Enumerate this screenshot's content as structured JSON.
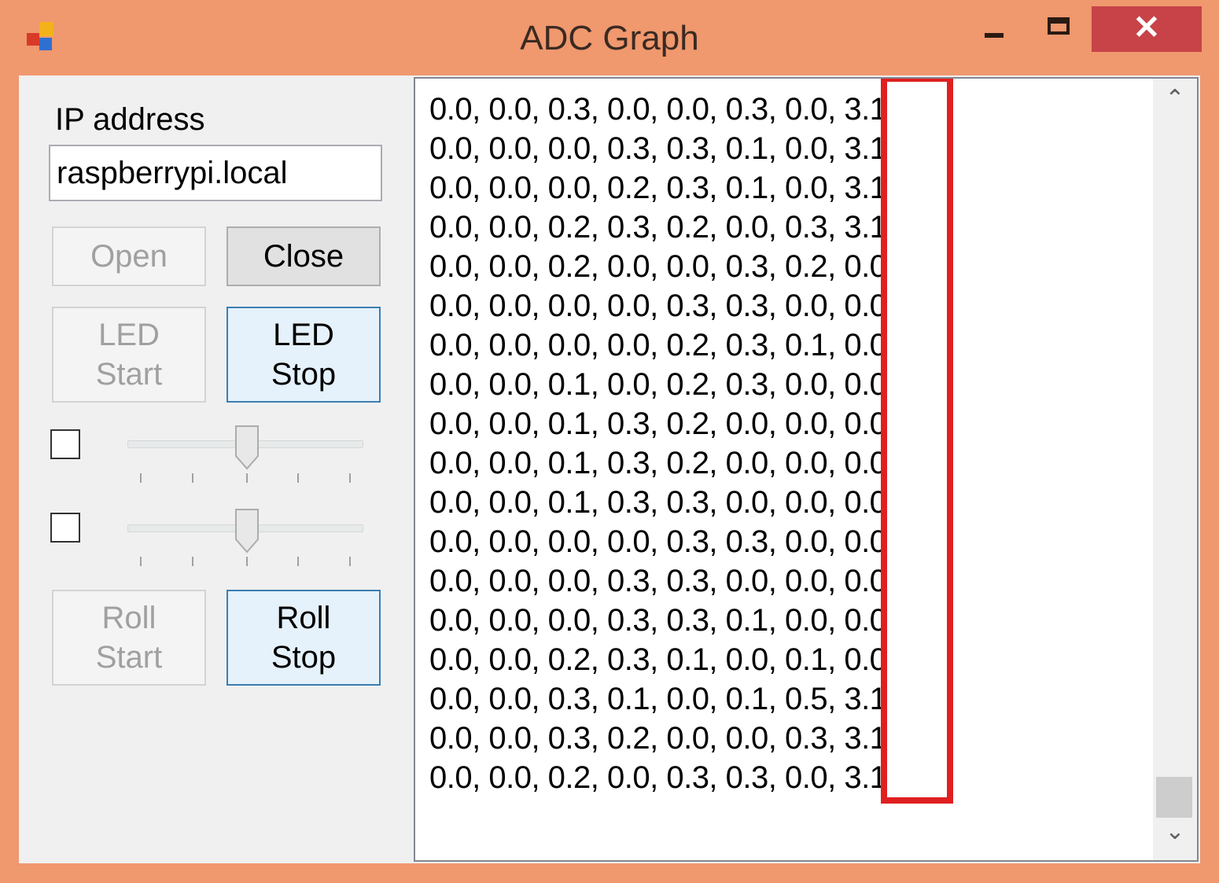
{
  "window": {
    "title": "ADC Graph"
  },
  "titlebar": {
    "minimize": "minimize-icon",
    "maximize": "maximize-icon",
    "close_glyph": "✕"
  },
  "connection": {
    "ip_label": "IP address",
    "ip_value": "raspberrypi.local",
    "open_label": "Open",
    "close_label": "Close"
  },
  "led": {
    "start_label": "LED\nStart",
    "stop_label": "LED\nStop"
  },
  "sliders": [
    {
      "checked": false,
      "level": 0.5
    },
    {
      "checked": false,
      "level": 0.5
    }
  ],
  "roll": {
    "start_label": "Roll\nStart",
    "stop_label": "Roll\nStop"
  },
  "log": {
    "lines": [
      "0.0, 0.0, 0.3, 0.0, 0.0, 0.3, 0.0, 3.1",
      "0.0, 0.0, 0.0, 0.3, 0.3, 0.1, 0.0, 3.1",
      "0.0, 0.0, 0.0, 0.2, 0.3, 0.1, 0.0, 3.1",
      "0.0, 0.0, 0.2, 0.3, 0.2, 0.0, 0.3, 3.1",
      "0.0, 0.0, 0.2, 0.0, 0.0, 0.3, 0.2, 0.0",
      "0.0, 0.0, 0.0, 0.0, 0.3, 0.3, 0.0, 0.0",
      "0.0, 0.0, 0.0, 0.0, 0.2, 0.3, 0.1, 0.0",
      "0.0, 0.0, 0.1, 0.0, 0.2, 0.3, 0.0, 0.0",
      "0.0, 0.0, 0.1, 0.3, 0.2, 0.0, 0.0, 0.0",
      "0.0, 0.0, 0.1, 0.3, 0.2, 0.0, 0.0, 0.0",
      "0.0, 0.0, 0.1, 0.3, 0.3, 0.0, 0.0, 0.0",
      "0.0, 0.0, 0.0, 0.0, 0.3, 0.3, 0.0, 0.0",
      "0.0, 0.0, 0.0, 0.3, 0.3, 0.0, 0.0, 0.0",
      "0.0, 0.0, 0.0, 0.3, 0.3, 0.1, 0.0, 0.0",
      "0.0, 0.0, 0.2, 0.3, 0.1, 0.0, 0.1, 0.0",
      "0.0, 0.0, 0.3, 0.1, 0.0, 0.1, 0.5, 3.1",
      "0.0, 0.0, 0.3, 0.2, 0.0, 0.0, 0.3, 3.1",
      "0.0, 0.0, 0.2, 0.0, 0.3, 0.3, 0.0, 3.1"
    ]
  },
  "scrollbar": {
    "up": "scroll-up-icon",
    "down": "scroll-down-icon"
  },
  "colors": {
    "frame": "#F0986E",
    "close": "#C74348",
    "highlight": "#E02020",
    "focus_border": "#3C7FB1"
  }
}
